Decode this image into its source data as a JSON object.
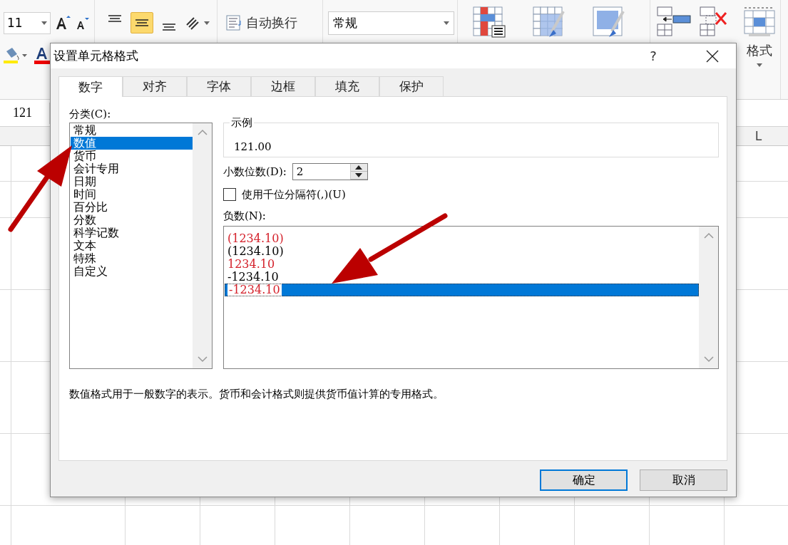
{
  "ribbon": {
    "font_size": "11",
    "align_buttons": [
      {
        "kind": "top",
        "selected": false
      },
      {
        "kind": "middle",
        "selected": true
      },
      {
        "kind": "bottom",
        "selected": false
      }
    ],
    "wrap_text": "自动换行",
    "number_format": "常规",
    "format_label": "格式"
  },
  "name_box": "121",
  "column_header": "L",
  "dialog": {
    "title": "设置单元格格式",
    "help": "?",
    "tabs": [
      {
        "label": "数字",
        "selected": true
      },
      {
        "label": "对齐",
        "selected": false
      },
      {
        "label": "字体",
        "selected": false
      },
      {
        "label": "边框",
        "selected": false
      },
      {
        "label": "填充",
        "selected": false
      },
      {
        "label": "保护",
        "selected": false
      }
    ],
    "category_label": "分类(C):",
    "categories": [
      {
        "label": "常规",
        "selected": false
      },
      {
        "label": "数值",
        "selected": true
      },
      {
        "label": "货币",
        "selected": false
      },
      {
        "label": "会计专用",
        "selected": false
      },
      {
        "label": "日期",
        "selected": false
      },
      {
        "label": "时间",
        "selected": false
      },
      {
        "label": "百分比",
        "selected": false
      },
      {
        "label": "分数",
        "selected": false
      },
      {
        "label": "科学记数",
        "selected": false
      },
      {
        "label": "文本",
        "selected": false
      },
      {
        "label": "特殊",
        "selected": false
      },
      {
        "label": "自定义",
        "selected": false
      }
    ],
    "sample_label": "示例",
    "sample_value": "121.00",
    "decimal_label": "小数位数(D):",
    "decimal_value": "2",
    "separator": {
      "label": "使用千位分隔符(,)(U)",
      "checked": false
    },
    "negative_label": "负数(N):",
    "negatives": [
      {
        "label": "(1234.10)",
        "color": "#d4202a",
        "selected": false
      },
      {
        "label": "(1234.10)",
        "color": "#000000",
        "selected": false
      },
      {
        "label": "1234.10",
        "color": "#d4202a",
        "selected": false
      },
      {
        "label": "-1234.10",
        "color": "#000000",
        "selected": false
      },
      {
        "label": "-1234.10",
        "color": "#d4202a",
        "selected": true
      }
    ],
    "description": "数值格式用于一般数字的表示。货币和会计格式则提供货币值计算的专用格式。",
    "buttons": [
      {
        "label": "确定",
        "default": true
      },
      {
        "label": "取消",
        "default": false
      }
    ]
  }
}
